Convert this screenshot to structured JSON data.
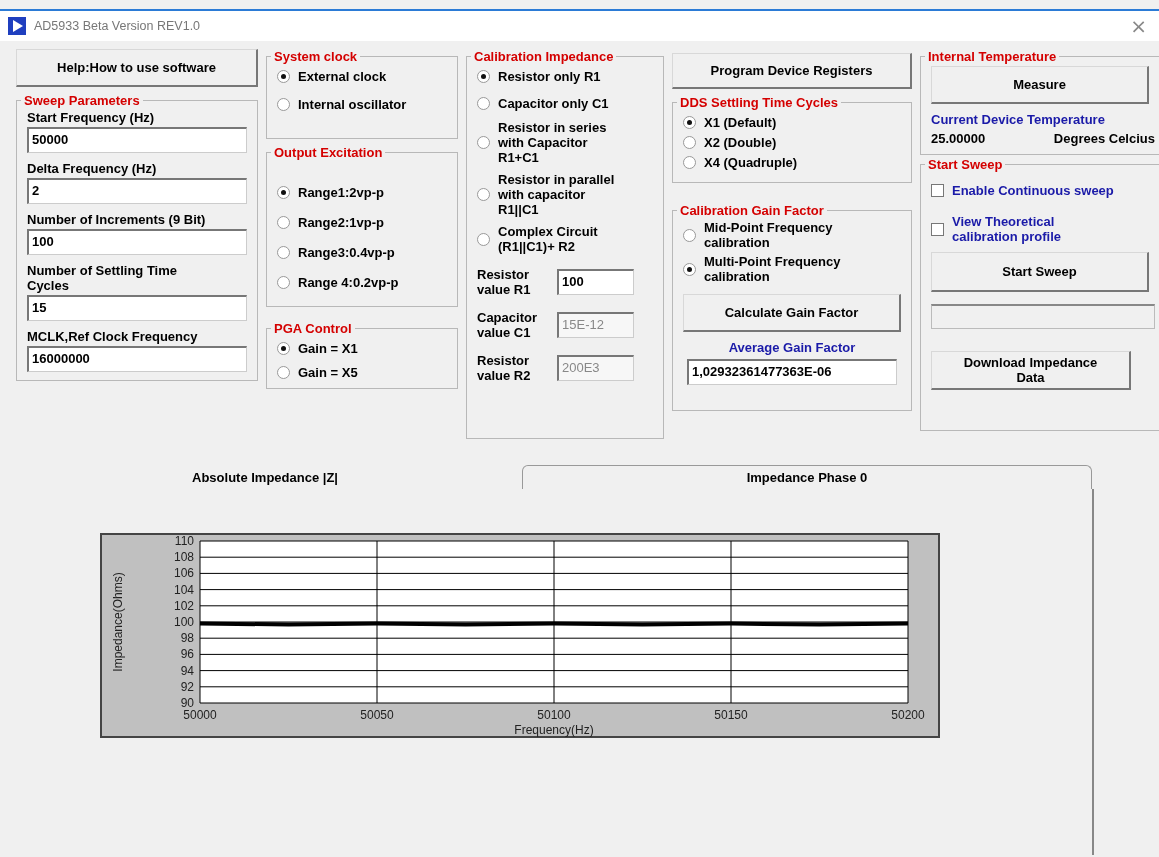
{
  "window": {
    "title": "AD5933 Beta Version REV1.0",
    "close": "×"
  },
  "help_button": "Help:How to use software",
  "sweep_parameters": {
    "title": "Sweep Parameters",
    "fields": [
      {
        "label": "Start Frequency (Hz)",
        "value": "50000"
      },
      {
        "label": "Delta Frequency (Hz)",
        "value": "2"
      },
      {
        "label": "Number of Increments (9 Bit)",
        "value": "100"
      },
      {
        "label": "Number of Settling Time\nCycles",
        "value": "15"
      },
      {
        "label": "MCLK,Ref Clock Frequency",
        "value": "16000000"
      }
    ]
  },
  "system_clock": {
    "title": "System clock",
    "options": [
      {
        "label": "External clock",
        "selected": true
      },
      {
        "label": "Internal oscillator",
        "selected": false
      }
    ]
  },
  "output_excitation": {
    "title": "Output Excitation",
    "options": [
      {
        "label": "Range1:2vp-p",
        "selected": true
      },
      {
        "label": "Range2:1vp-p",
        "selected": false
      },
      {
        "label": "Range3:0.4vp-p",
        "selected": false
      },
      {
        "label": "Range 4:0.2vp-p",
        "selected": false
      }
    ]
  },
  "pga_control": {
    "title": "PGA Control",
    "options": [
      {
        "label": "Gain = X1",
        "selected": true
      },
      {
        "label": "Gain = X5",
        "selected": false
      }
    ]
  },
  "calibration_impedance": {
    "title": "Calibration Impedance",
    "options": [
      {
        "label": "Resistor only R1",
        "selected": true
      },
      {
        "label": "Capacitor only C1",
        "selected": false
      },
      {
        "label": "Resistor in series\nwith Capacitor\nR1+C1",
        "selected": false
      },
      {
        "label": "Resistor in parallel\nwith capacitor\nR1||C1",
        "selected": false
      },
      {
        "label": "Complex Circuit\n(R1||C1)+ R2",
        "selected": false
      }
    ],
    "fields": [
      {
        "label": "Resistor\nvalue R1",
        "value": "100",
        "disabled": false
      },
      {
        "label": "Capacitor\nvalue C1",
        "value": "15E-12",
        "disabled": true
      },
      {
        "label": "Resistor\nvalue R2",
        "value": "200E3",
        "disabled": true
      }
    ]
  },
  "program_button": "Program Device Registers",
  "dds_settling": {
    "title": "DDS Settling Time Cycles",
    "options": [
      {
        "label": "X1 (Default)",
        "selected": true
      },
      {
        "label": "X2 (Double)",
        "selected": false
      },
      {
        "label": "X4 (Quadruple)",
        "selected": false
      }
    ]
  },
  "calibration_gain": {
    "title": "Calibration Gain Factor",
    "options": [
      {
        "label": "Mid-Point Frequency\ncalibration",
        "selected": false
      },
      {
        "label": "Multi-Point Frequency\ncalibration",
        "selected": true
      }
    ],
    "button": "Calculate Gain Factor",
    "result_label": "Average Gain Factor",
    "result_value": "1,02932361477363E-06"
  },
  "internal_temperature": {
    "title": "Internal Temperature",
    "button": "Measure",
    "label": "Current Device Temperature",
    "value": "25.00000",
    "unit": "Degrees Celcius"
  },
  "start_sweep": {
    "title": "Start Sweep",
    "checkboxes": [
      {
        "label": "Enable Continuous sweep",
        "checked": false
      },
      {
        "label": "View Theoretical\ncalibration profile",
        "checked": false
      }
    ],
    "button": "Start Sweep",
    "progress": {
      "level": 0
    },
    "download_button": "Download Impedance\nData"
  },
  "tabs": [
    {
      "label": "Absolute Impedance |Z|",
      "selected": true
    },
    {
      "label": "Impedance Phase  0",
      "selected": false
    }
  ],
  "chart_data": {
    "type": "line",
    "xlabel": "Frequency(Hz)",
    "ylabel": "Impedance(Ohms)",
    "x": [
      50000,
      50025,
      50050,
      50075,
      50100,
      50125,
      50150,
      50175,
      50200
    ],
    "series": [
      {
        "color": "#000000",
        "values": [
          99.8,
          99.7,
          99.8,
          99.7,
          99.8,
          99.7,
          99.8,
          99.7,
          99.8
        ]
      }
    ],
    "grid": true,
    "xlim": [
      50000,
      50200
    ],
    "ylim": [
      90,
      110
    ],
    "xticks": [
      50000,
      50050,
      50100,
      50150,
      50200
    ],
    "yticks": [
      90,
      92,
      94,
      96,
      98,
      100,
      102,
      104,
      106,
      108,
      110
    ]
  }
}
